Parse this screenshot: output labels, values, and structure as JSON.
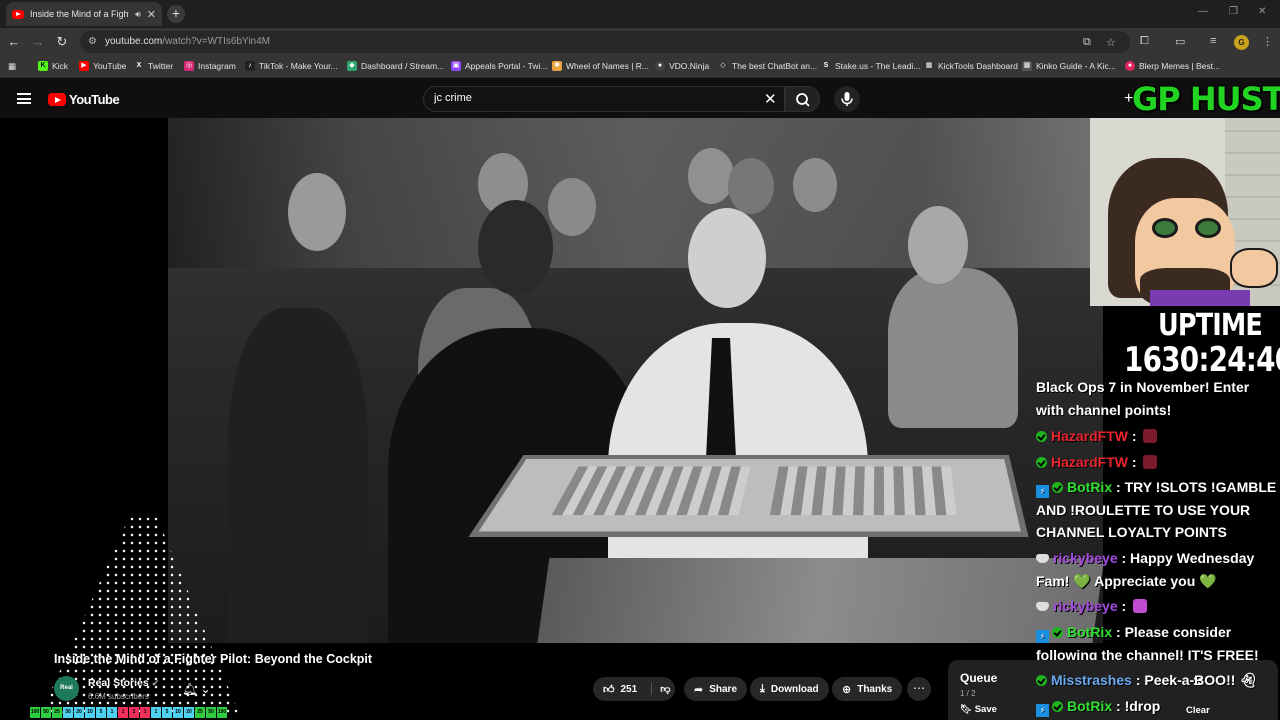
{
  "browser": {
    "tab_title": "Inside the Mind of a Fighte",
    "url_host": "youtube.com",
    "url_path": "/watch?v=WTIs6bYin4M",
    "profile_initial": "G",
    "bookmarks": [
      {
        "label": "Kick",
        "color": "#53fc18"
      },
      {
        "label": "YouTube",
        "color": "#ff0000"
      },
      {
        "label": "Twitter",
        "color": "#333333"
      },
      {
        "label": "Instagram",
        "color": "#d62976"
      },
      {
        "label": "TikTok - Make Your...",
        "color": "#222222"
      },
      {
        "label": "Dashboard / Stream...",
        "color": "#2ea56f"
      },
      {
        "label": "Appeals Portal - Twi...",
        "color": "#9146ff"
      },
      {
        "label": "Wheel of Names | R...",
        "color": "#e8a33c"
      },
      {
        "label": "VDO.Ninja",
        "color": "#444444"
      },
      {
        "label": "The best ChatBot an...",
        "color": "#333333"
      },
      {
        "label": "Stake.us - The Leadi...",
        "color": "#333333"
      },
      {
        "label": "KickTools Dashboard",
        "color": "#333333"
      },
      {
        "label": "Kinko Guide - A Kic...",
        "color": "#555555"
      },
      {
        "label": "Blerp Memes | Best...",
        "color": "#e0245e"
      }
    ]
  },
  "youtube": {
    "logo_text": "YouTube",
    "search_value": "jc crime",
    "video_title": "Inside the Mind of a Fighter Pilot: Beyond the Cockpit",
    "channel_name": "Real Stories",
    "channel_subs": "6.6M subscribers",
    "channel_avatar_text": "Real Stories",
    "likes": "251",
    "share_label": "Share",
    "download_label": "Download",
    "thanks_label": "Thanks",
    "queue": {
      "title": "Queue",
      "count": "1 / 2",
      "save_label": "Save",
      "clear_label": "Clear"
    }
  },
  "overlay": {
    "banner": "GP HUSTLA",
    "uptime_label": "UPTIME",
    "uptime_value": "1630:24:40",
    "announcement": "Black Ops 7 in November! Enter with channel points!",
    "chat": [
      {
        "user": "HazardFTW",
        "text": " : ",
        "color": "red"
      },
      {
        "user": "HazardFTW",
        "text": " : ",
        "color": "red"
      },
      {
        "user": "BotRix",
        "text": " : TRY !SLOTS !GAMBLE AND !ROULETTE TO USE YOUR CHANNEL LOYALTY POINTS",
        "color": "green"
      },
      {
        "user": "rickybeye",
        "text": " : Happy Wednesday Fam! 💚 Appreciate you 💚",
        "color": "purple"
      },
      {
        "user": "rickybeye",
        "text": " : ",
        "color": "purple"
      },
      {
        "user": "BotRix",
        "text": " : Please consider following the channel! IT'S FREE!",
        "color": "green"
      },
      {
        "user": "Misstrashes",
        "text": " : Peek-a-BOO!! ",
        "color": "blue"
      },
      {
        "user": "BotRix",
        "text": " : !drop",
        "color": "green"
      }
    ],
    "level_numbers": [
      "100",
      "50",
      "25",
      "30",
      "20",
      "10",
      "5",
      "1",
      "1",
      "2",
      "1",
      "1",
      "5",
      "10",
      "20",
      "25",
      "50",
      "100"
    ]
  }
}
